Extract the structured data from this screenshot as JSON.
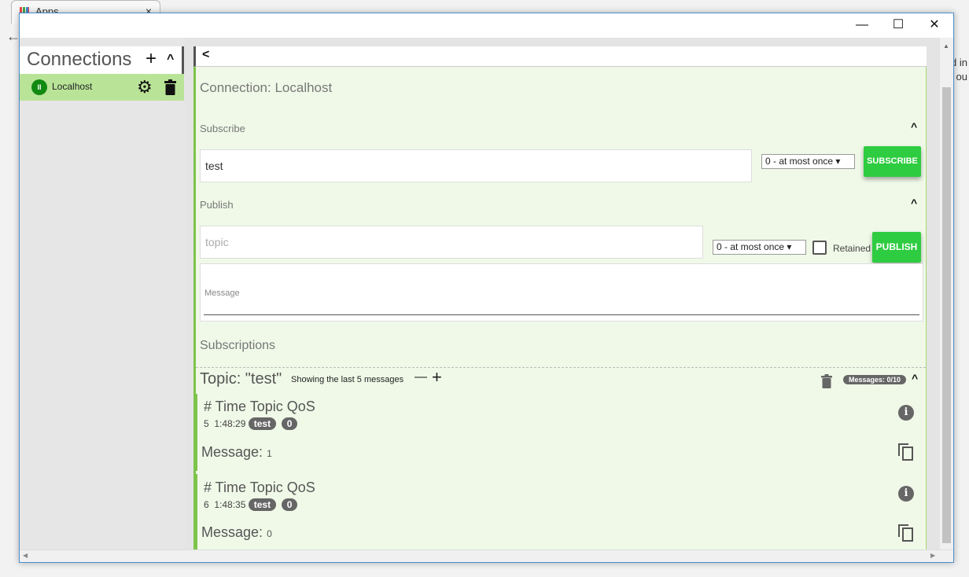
{
  "browser": {
    "tab_label": "Apps",
    "bg_fragments": [
      "d in",
      "g ou"
    ]
  },
  "window": {
    "minimize": "—",
    "maximize": "☐",
    "close": "✕"
  },
  "sidebar": {
    "title": "Connections",
    "add_icon": "+",
    "collapse_icon": "^",
    "connections": [
      {
        "name": "Localhost",
        "status": "connected",
        "pause_icon": "II"
      }
    ]
  },
  "main": {
    "back_icon": "<",
    "connection_title": "Connection: Localhost",
    "subscribe": {
      "label": "Subscribe",
      "topic_value": "test",
      "qos": "0 - at most once",
      "button": "SUBSCRIBE"
    },
    "publish": {
      "label": "Publish",
      "topic_placeholder": "topic",
      "qos": "0 - at most once",
      "retained_label": "Retained",
      "retained": false,
      "button": "PUBLISH",
      "message_placeholder": "Message"
    },
    "subscriptions": {
      "label": "Subscriptions",
      "topic": {
        "title": "Topic: \"test\"",
        "showing": "Showing the last 5 messages",
        "minus": "—",
        "plus": "+",
        "messages_badge": "Messages: 0/10",
        "messages": [
          {
            "header": "# Time Topic QoS",
            "num": "5",
            "time": "1:48:29",
            "topic": "test",
            "qos": "0",
            "message_label": "Message:",
            "message": "1"
          },
          {
            "header": "# Time Topic QoS",
            "num": "6",
            "time": "1:48:35",
            "topic": "test",
            "qos": "0",
            "message_label": "Message:",
            "message": "0"
          }
        ]
      }
    }
  },
  "colors": {
    "accent": "#2ecc40",
    "panel_bg": "#f0f9e8",
    "connection_active": "#b9e498",
    "border_green": "#7dc44a"
  }
}
